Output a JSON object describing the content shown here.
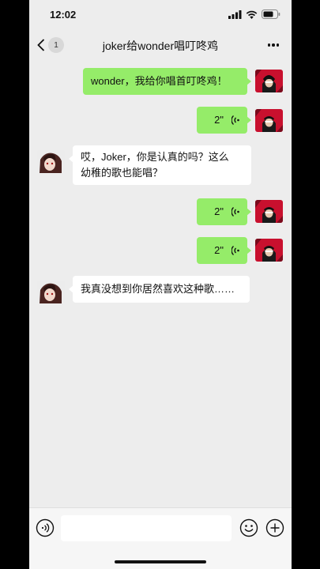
{
  "status_bar": {
    "time": "12:02"
  },
  "nav": {
    "unread_count": "1",
    "title": "joker给wonder唱叮咚鸡"
  },
  "messages": [
    {
      "sender": "me",
      "type": "text",
      "text": "wonder，我给你唱首叮咚鸡！"
    },
    {
      "sender": "me",
      "type": "voice",
      "duration": "2\""
    },
    {
      "sender": "them",
      "type": "text",
      "lines": [
        "哎，Joker，你是认真的吗？这么",
        "幼稚的歌也能唱？"
      ]
    },
    {
      "sender": "me",
      "type": "voice",
      "duration": "2\""
    },
    {
      "sender": "me",
      "type": "voice",
      "duration": "2\""
    },
    {
      "sender": "them",
      "type": "text",
      "text": "我真没想到你居然喜欢这种歌……"
    }
  ],
  "input": {
    "placeholder": ""
  },
  "colors": {
    "my_bubble": "#95ec69",
    "their_bubble": "#ffffff",
    "background": "#ededed"
  }
}
